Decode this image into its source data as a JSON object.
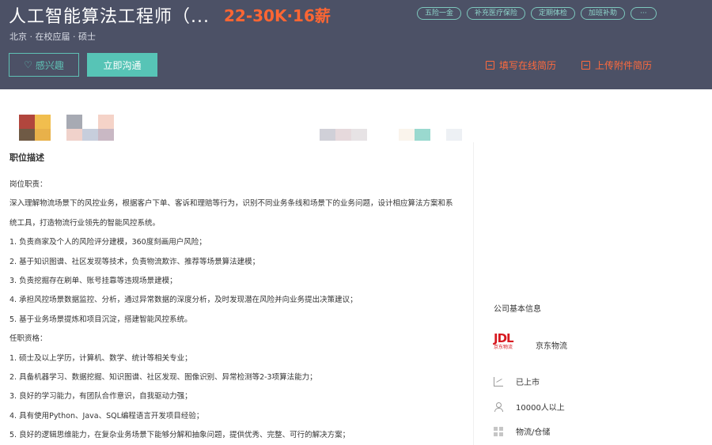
{
  "header": {
    "job_title": "人工智能算法工程师（...",
    "salary": "22-30K·16薪",
    "meta": "北京 · 在校应届 · 硕士",
    "tags": [
      "五险一金",
      "补充医疗保险",
      "定期体检",
      "加班补助",
      "···"
    ],
    "like_label": "感兴趣",
    "chat_label": "立即沟通",
    "fill_resume_label": "填写在线简历",
    "upload_resume_label": "上传附件简历"
  },
  "colors": {
    "header_bg": "#4c5166",
    "salary": "#ff6633",
    "accent": "#57c4b6",
    "resume_link": "#ff6a3d",
    "brand_red": "#d71920"
  },
  "job": {
    "section_title": "职位描述",
    "lines": [
      "岗位职责：",
      "深入理解物流场景下的风控业务，根据客户下单、客诉和理赔等行为，识别不同业务条线和场景下的业务问题，设计相应算法方案和系",
      "统工具，打造物流行业领先的智能风控系统。",
      "1.      负责商家及个人的风险评分建模，360度刻画用户风险；",
      "2.      基于知识图谱、社区发现等技术，负责物流欺诈、推荐等场景算法建模；",
      "3.      负责挖掘存在刷单、账号挂靠等违规场景建模；",
      "4.      承担风控场景数据监控、分析，通过异常数据的深度分析，及时发现潜在风险并向业务提出决策建议；",
      "5.  基于业务场景提炼和项目沉淀，搭建智能风控系统。",
      "任职资格：",
      "1.  硕士及以上学历，计算机、数学、统计等相关专业；",
      "2.  具备机器学习、数据挖掘、知识图谱、社区发现、图像识别、异常检测等2-3项算法能力；",
      "3.  良好的学习能力，有团队合作意识，自我驱动力强；",
      "4.  具有使用Python、Java、SQL编程语言开发项目经验；",
      "5.  良好的逻辑思维能力，在复杂业务场景下能够分解和抽象问题，提供优秀、完整、可行的解决方案；"
    ]
  },
  "company": {
    "section_title": "公司基本信息",
    "logo_text": "JDL",
    "logo_sub": "京东物流",
    "name": "京东物流",
    "stage": "已上市",
    "size": "10000人以上",
    "industry": "物流/仓储",
    "icons": [
      "chart-icon",
      "user-icon",
      "grid-icon"
    ]
  }
}
